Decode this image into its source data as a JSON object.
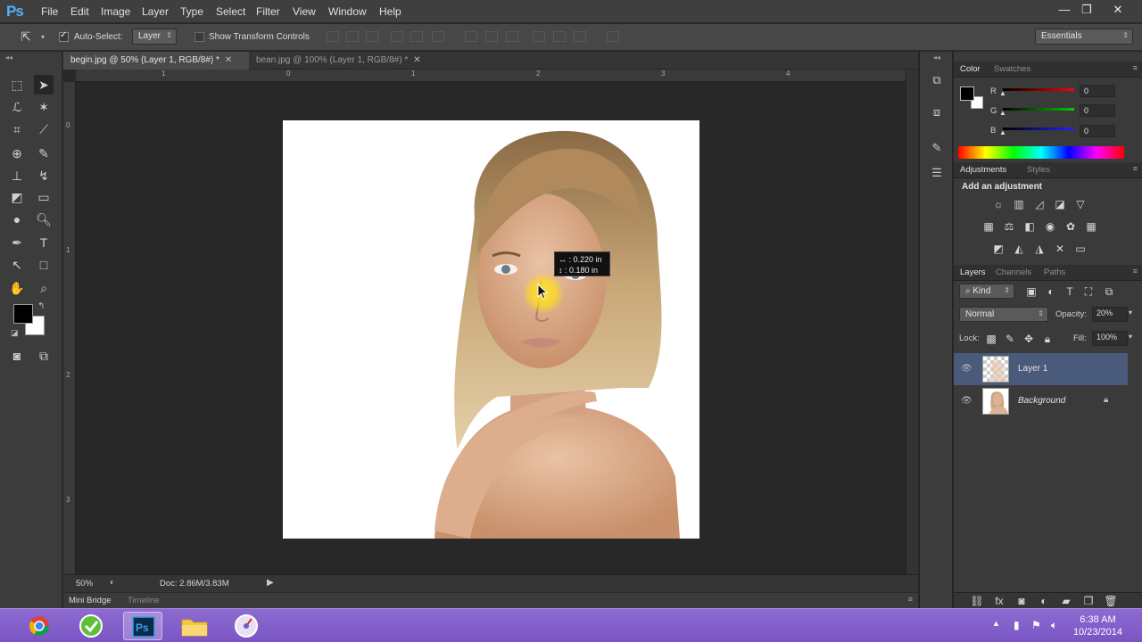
{
  "app": {
    "logo": "Ps"
  },
  "menu": [
    "File",
    "Edit",
    "Image",
    "Layer",
    "Type",
    "Select",
    "Filter",
    "View",
    "Window",
    "Help"
  ],
  "window_controls": {
    "minimize": "—",
    "restore": "❐",
    "close": "✕"
  },
  "options": {
    "auto_select_label": "Auto-Select:",
    "auto_select_checked": true,
    "auto_select_target": "Layer",
    "show_transform_label": "Show Transform Controls",
    "show_transform_checked": false,
    "workspace": "Essentials"
  },
  "tabs": [
    {
      "label": "begin.jpg @ 50% (Layer 1, RGB/8#) *",
      "active": true
    },
    {
      "label": "bean.jpg @ 100% (Layer 1, RGB/8#) *",
      "active": false
    }
  ],
  "ruler": {
    "top_ticks": [
      "1",
      "0",
      "1",
      "2",
      "3",
      "4"
    ],
    "left_ticks": [
      "0",
      "1",
      "2",
      "3"
    ]
  },
  "measure_tooltip": {
    "dx": "0.220 in",
    "dy": "0.180 in"
  },
  "status": {
    "zoom": "50%",
    "doc": "Doc: 2.86M/3.83M"
  },
  "bottom_tabs": [
    "Mini Bridge",
    "Timeline"
  ],
  "color_panel": {
    "tabs": [
      "Color",
      "Swatches"
    ],
    "r_label": "R",
    "r_value": "0",
    "g_label": "G",
    "g_value": "0",
    "b_label": "B",
    "b_value": "0",
    "foreground": "#000000",
    "background": "#ffffff"
  },
  "adjustments_panel": {
    "tabs": [
      "Adjustments",
      "Styles"
    ],
    "heading": "Add an adjustment"
  },
  "layers_panel": {
    "tabs": [
      "Layers",
      "Channels",
      "Paths"
    ],
    "filter_kind": "Kind",
    "blend_mode": "Normal",
    "opacity_label": "Opacity:",
    "opacity": "20%",
    "lock_label": "Lock:",
    "fill_label": "Fill:",
    "fill": "100%",
    "layers": [
      {
        "name": "Layer 1",
        "selected": true
      },
      {
        "name": "Background",
        "selected": false,
        "locked": true
      }
    ]
  },
  "taskbar": {
    "time": "6:38 AM",
    "date": "10/23/2014",
    "apps": [
      "chrome-icon",
      "green-app-icon",
      "photoshop-icon",
      "folder-icon",
      "media-icon"
    ],
    "active_app": "photoshop-icon"
  }
}
